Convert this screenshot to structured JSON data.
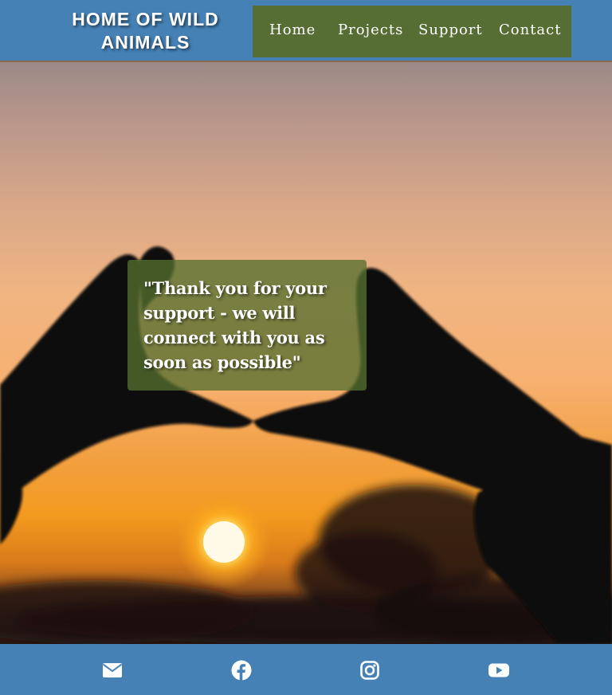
{
  "header": {
    "brand_line1": "HOME OF WILD",
    "brand_line2": "ANIMALS",
    "nav": {
      "home": "Home",
      "projects": "Projects",
      "support": "Support",
      "contact": "Contact"
    }
  },
  "hero": {
    "quote": "\"Thank you for your support - we will connect with you as soon as possible\""
  },
  "footer": {
    "icons": [
      "envelope-icon",
      "facebook-icon",
      "instagram-icon",
      "youtube-icon"
    ]
  },
  "colors": {
    "header_bg": "#4581b5",
    "nav_bg": "#566d33",
    "quote_bg": "#567030",
    "text": "#ffffff"
  }
}
